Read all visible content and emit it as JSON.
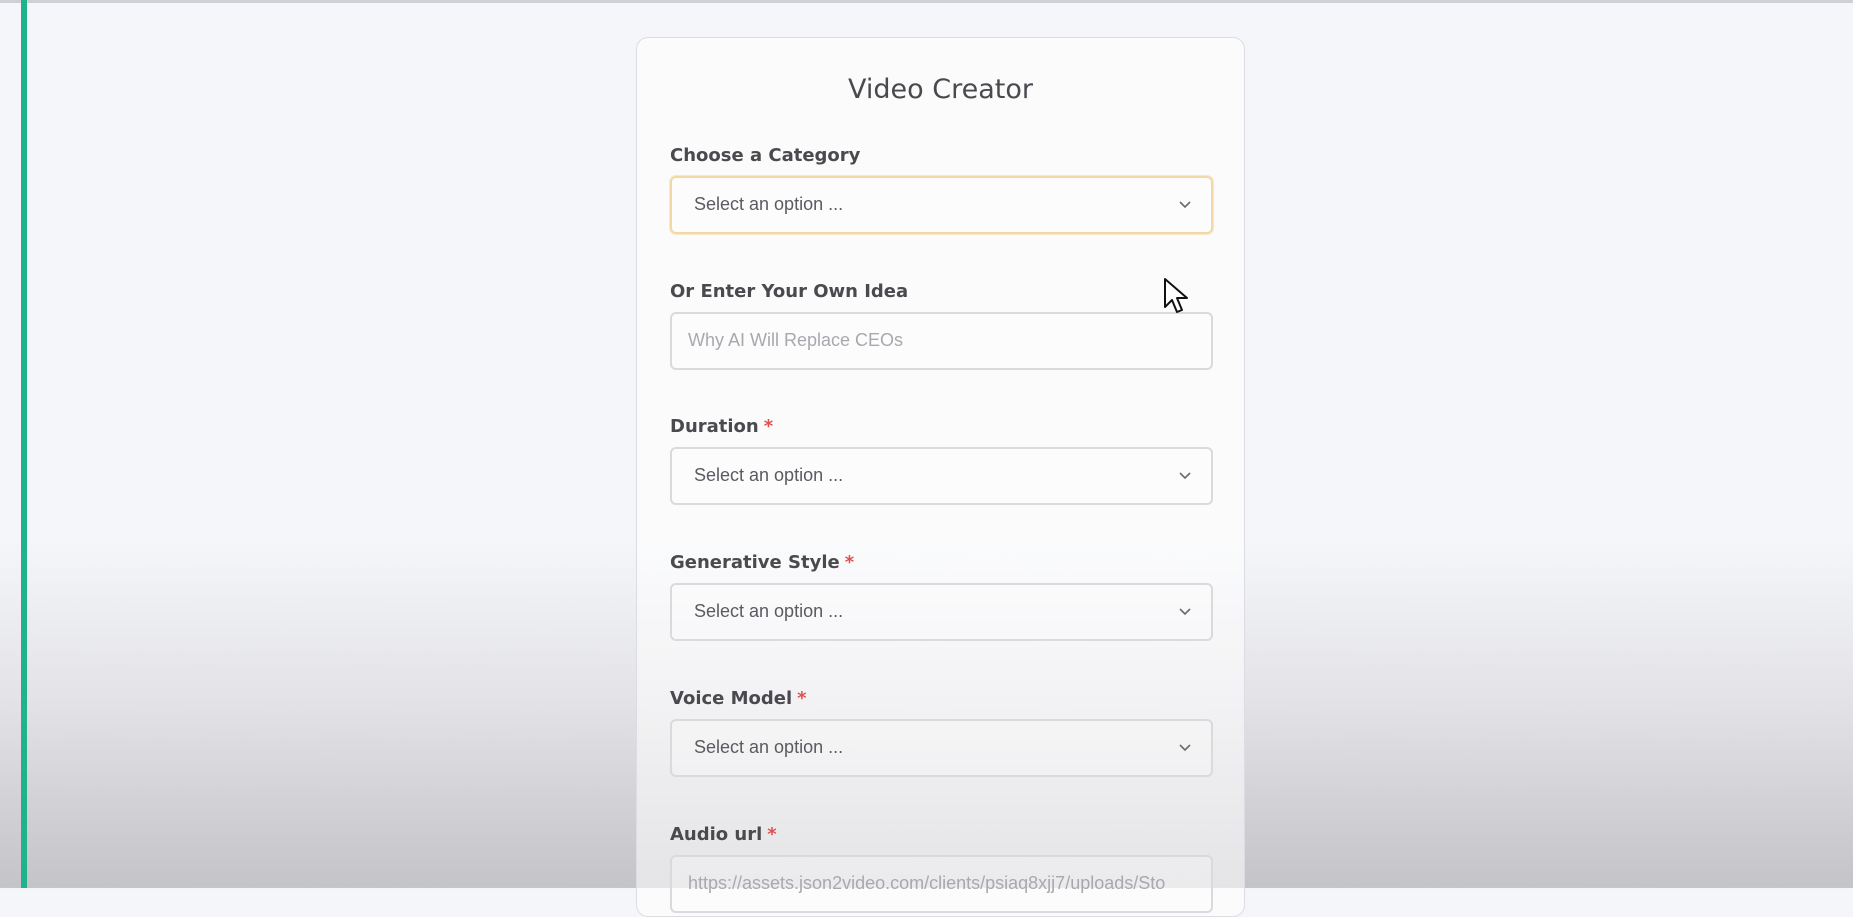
{
  "form": {
    "title": "Video Creator",
    "category": {
      "label": "Choose a Category",
      "value": "Select an option ..."
    },
    "idea": {
      "label": "Or Enter Your Own Idea",
      "placeholder": "Why AI Will Replace CEOs"
    },
    "duration": {
      "label": "Duration",
      "required_mark": "*",
      "value": "Select an option ..."
    },
    "style": {
      "label": "Generative Style",
      "required_mark": "*",
      "value": "Select an option ..."
    },
    "voice": {
      "label": "Voice Model",
      "required_mark": "*",
      "value": "Select an option ..."
    },
    "audio": {
      "label": "Audio url",
      "required_mark": "*",
      "value": "https://assets.json2video.com/clients/psiaq8xjj7/uploads/Sto"
    }
  },
  "colors": {
    "accent_bar": "#1fb28c",
    "required": "#e05050",
    "focus_border": "#f3d8a5"
  },
  "icons": {
    "select_chevron": "chevron-down-icon",
    "pointer": "mouse-cursor-icon"
  }
}
